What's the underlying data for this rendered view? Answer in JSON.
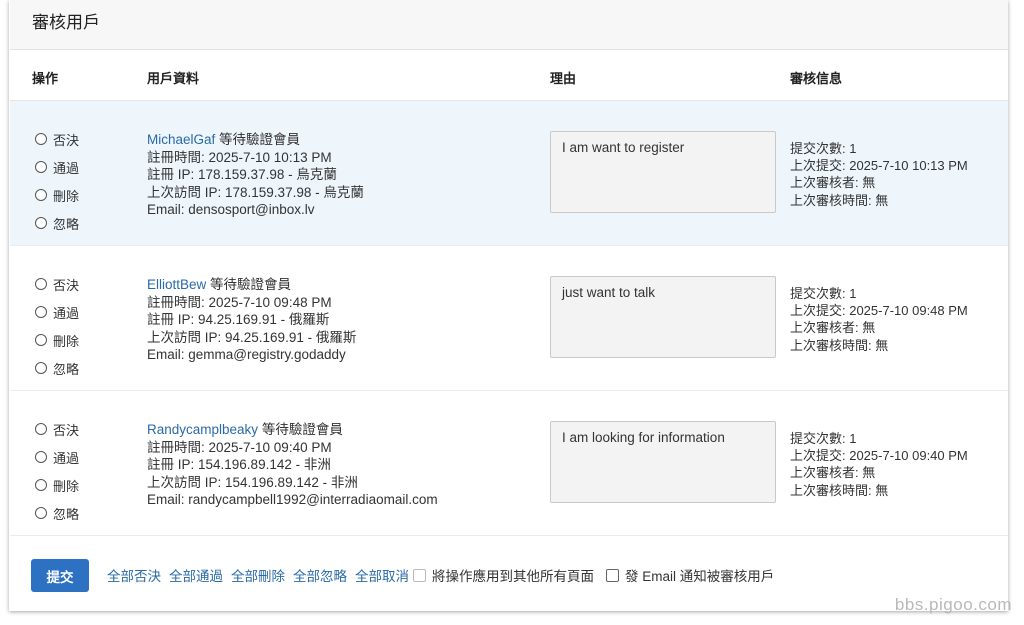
{
  "page": {
    "title": "審核用戶"
  },
  "columns": {
    "action": "操作",
    "user_info": "用戶資料",
    "reason": "理由",
    "review_info": "審核信息"
  },
  "radio_options": [
    "否決",
    "通過",
    "刪除",
    "忽略"
  ],
  "users": [
    {
      "username": "MichaelGaf",
      "status": "等待驗證會員",
      "reg_time": "註冊時間: 2025-7-10 10:13 PM",
      "reg_ip": "註冊 IP: 178.159.37.98 - 烏克蘭",
      "last_ip": "上次訪問 IP: 178.159.37.98 - 烏克蘭",
      "email": "Email: densosport@inbox.lv",
      "reason": "I am want to register",
      "submit_count": "提交次數: 1",
      "last_submit": "上次提交: 2025-7-10 10:13 PM",
      "last_reviewer": "上次審核者: 無",
      "last_review_time": "上次審核時間: 無"
    },
    {
      "username": "ElliottBew",
      "status": "等待驗證會員",
      "reg_time": "註冊時間: 2025-7-10 09:48 PM",
      "reg_ip": "註冊 IP: 94.25.169.91 - 俄羅斯",
      "last_ip": "上次訪問 IP: 94.25.169.91 - 俄羅斯",
      "email": "Email: gemma@registry.godaddy",
      "reason": "just want to talk",
      "submit_count": "提交次數: 1",
      "last_submit": "上次提交: 2025-7-10 09:48 PM",
      "last_reviewer": "上次審核者: 無",
      "last_review_time": "上次審核時間: 無"
    },
    {
      "username": "Randycamplbeaky",
      "status": "等待驗證會員",
      "reg_time": "註冊時間: 2025-7-10 09:40 PM",
      "reg_ip": "註冊 IP: 154.196.89.142 - 非洲",
      "last_ip": "上次訪問 IP: 154.196.89.142 - 非洲",
      "email": "Email: randycampbell1992@interradiaomail.com",
      "reason": "I am looking for information",
      "submit_count": "提交次數: 1",
      "last_submit": "上次提交: 2025-7-10 09:40 PM",
      "last_reviewer": "上次審核者: 無",
      "last_review_time": "上次審核時間: 無"
    }
  ],
  "footer": {
    "submit_label": "提交",
    "bulk_links": [
      "全部否決",
      "全部通過",
      "全部刪除",
      "全部忽略",
      "全部取消"
    ],
    "apply_all_label": "將操作應用到其他所有頁面",
    "email_notify_label": "發 Email 通知被審核用戶"
  },
  "watermark": "bbs.pigoo.com",
  "colors": {
    "accent": "#2d72c2",
    "link": "#2a6aa8",
    "row_highlight": "#eef6fc"
  }
}
